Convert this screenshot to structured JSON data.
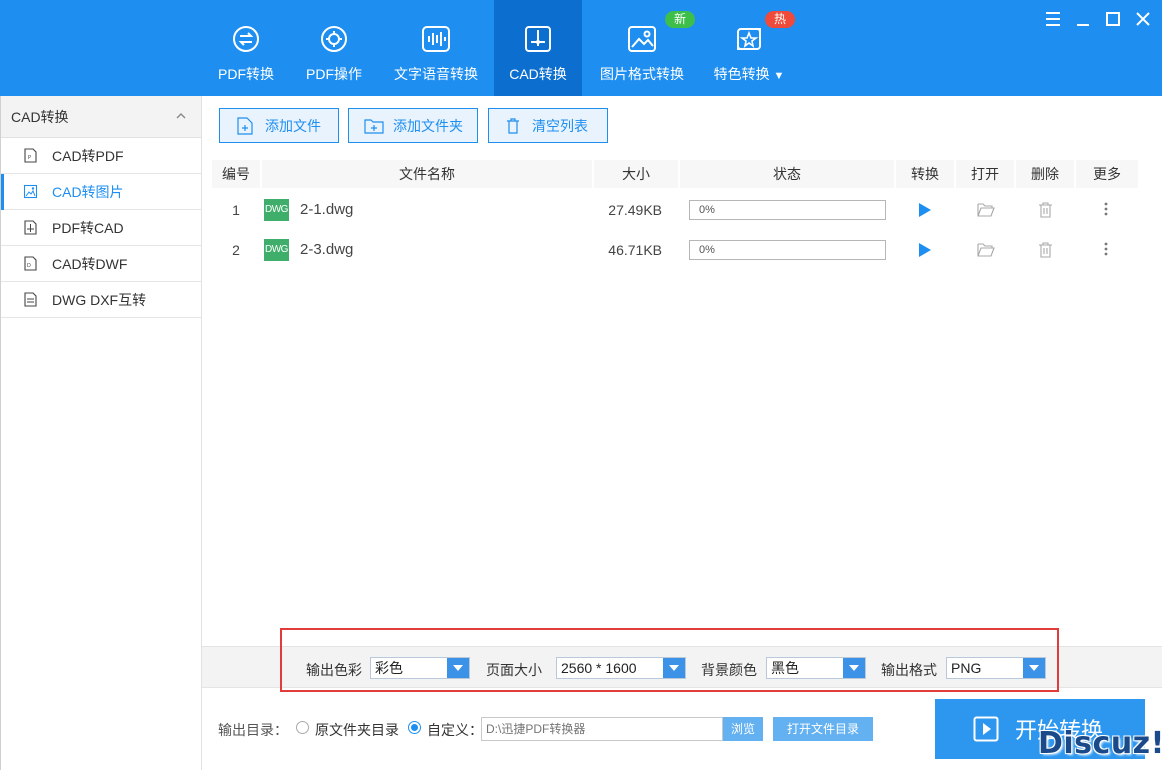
{
  "nav": {
    "tabs": [
      {
        "label": "PDF转换",
        "icon": "pdf-convert-icon"
      },
      {
        "label": "PDF操作",
        "icon": "pdf-gear-icon"
      },
      {
        "label": "文字语音转换",
        "icon": "voice-wave-icon"
      },
      {
        "label": "CAD转换",
        "icon": "cad-icon",
        "active": true
      },
      {
        "label": "图片格式转换",
        "icon": "image-icon",
        "badge": "新"
      },
      {
        "label": "特色转换",
        "icon": "special-convert-icon",
        "badge": "热"
      }
    ]
  },
  "sidebar": {
    "header": "CAD转换",
    "items": [
      {
        "label": "CAD转PDF",
        "icon": "pdf-file-icon"
      },
      {
        "label": "CAD转图片",
        "icon": "image-file-icon",
        "active": true
      },
      {
        "label": "PDF转CAD",
        "icon": "cad-file-icon"
      },
      {
        "label": "CAD转DWF",
        "icon": "dwf-file-icon"
      },
      {
        "label": "DWG DXF互转",
        "icon": "dwg-file-icon"
      }
    ]
  },
  "toolbar": {
    "add_file": "添加文件",
    "add_folder": "添加文件夹",
    "clear_list": "清空列表"
  },
  "table": {
    "headers": [
      "编号",
      "文件名称",
      "大小",
      "状态",
      "转换",
      "打开",
      "删除",
      "更多"
    ],
    "rows": [
      {
        "index": "1",
        "type": "DWG",
        "name": "2-1.dwg",
        "size": "27.49KB",
        "progress": "0%"
      },
      {
        "index": "2",
        "type": "DWG",
        "name": "2-3.dwg",
        "size": "46.71KB",
        "progress": "0%"
      }
    ]
  },
  "options": {
    "color_label": "输出色彩",
    "color_value": "彩色",
    "page_size_label": "页面大小",
    "page_size_value": "2560 * 1600",
    "bg_label": "背景颜色",
    "bg_value": "黑色",
    "format_label": "输出格式",
    "format_value": "PNG"
  },
  "output": {
    "label": "输出目录：",
    "original_dir": "原文件夹目录",
    "custom": "自定义：",
    "path_placeholder": "D:\\迅捷PDF转换器",
    "browse": "浏览",
    "open_dir": "打开文件目录",
    "start": "开始转换"
  },
  "watermark": "Discuz!",
  "colors": {
    "primary": "#1e8ff0",
    "active_tab": "#0c6fd0",
    "badge_new": "#3dbf4a",
    "badge_hot": "#f04a3a",
    "highlight": "#e03c3c"
  }
}
